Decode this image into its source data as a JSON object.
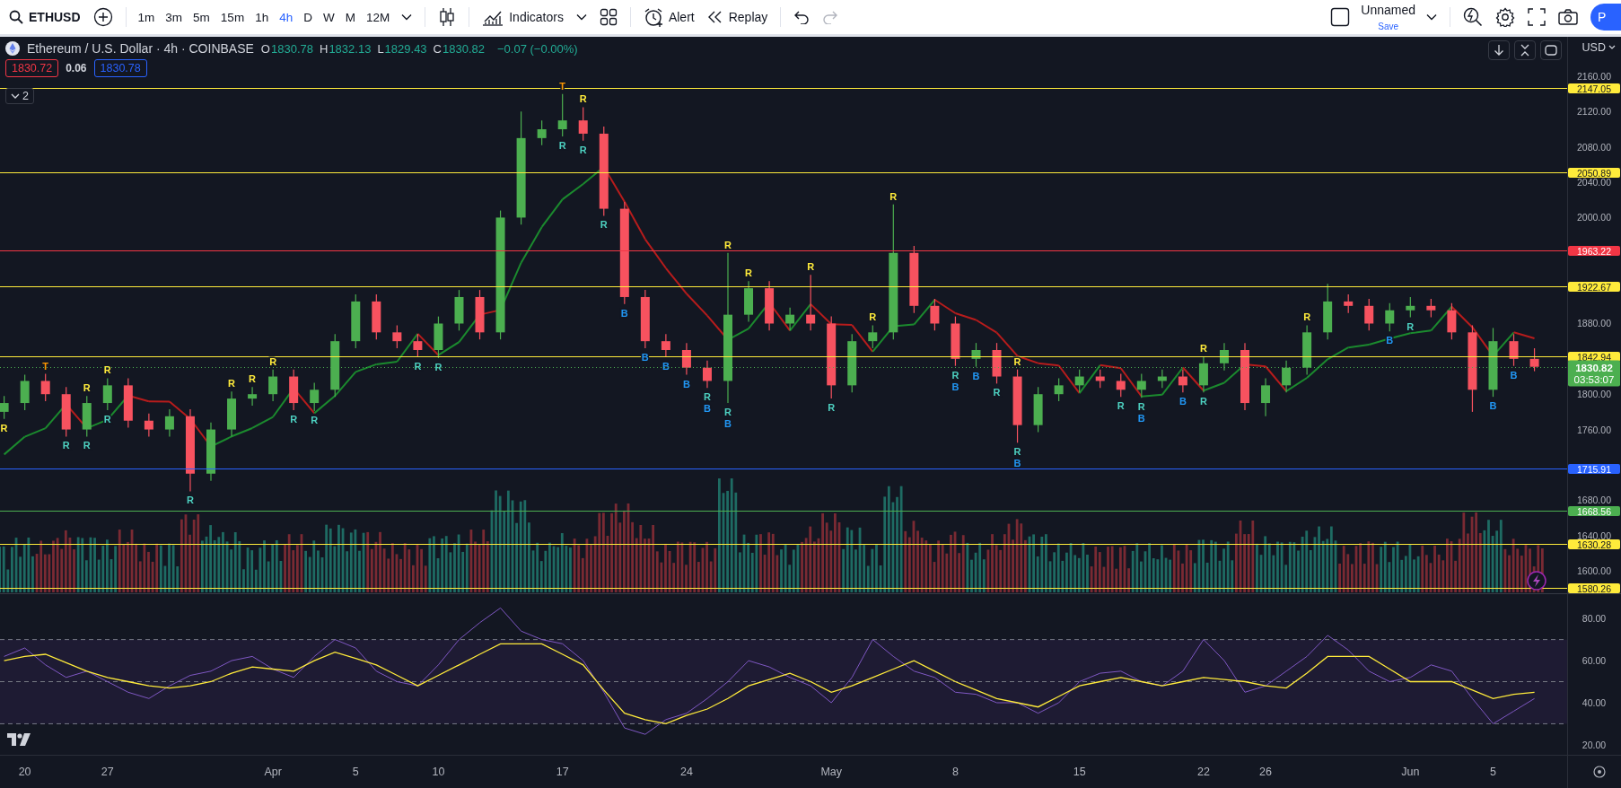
{
  "toolbar": {
    "symbol": "ETHUSD",
    "intervals": [
      {
        "label": "1m",
        "selected": false
      },
      {
        "label": "3m",
        "selected": false
      },
      {
        "label": "5m",
        "selected": false
      },
      {
        "label": "15m",
        "selected": false
      },
      {
        "label": "1h",
        "selected": false
      },
      {
        "label": "4h",
        "selected": true
      },
      {
        "label": "D",
        "selected": false
      },
      {
        "label": "W",
        "selected": false
      },
      {
        "label": "M",
        "selected": false
      },
      {
        "label": "12M",
        "selected": false
      }
    ],
    "indicators_label": "Indicators",
    "alert_label": "Alert",
    "replay_label": "Replay",
    "redo_disabled": true,
    "layout_name": "Unnamed",
    "layout_status": "Save",
    "avatar_letter": "P"
  },
  "legend": {
    "title": "Ethereum / U.S. Dollar · 4h · COINBASE",
    "ohlc": [
      {
        "key": "O",
        "value": "1830.78"
      },
      {
        "key": "H",
        "value": "1832.13"
      },
      {
        "key": "L",
        "value": "1829.43"
      },
      {
        "key": "C",
        "value": "1830.82"
      }
    ],
    "change": "−0.07 (−0.00%)",
    "bid": "1830.72",
    "spread": "0.06",
    "ask": "1830.78",
    "collapsed_count": "2"
  },
  "price_axis": {
    "currency": "USD"
  },
  "price_chart": {
    "last_price": {
      "label": "1830.82",
      "countdown": "03:53:07",
      "color": "#4caf50"
    },
    "signal_colors": [
      {
        "color": "#ffeb3b"
      },
      {
        "color": "#ff9800"
      },
      {
        "color": "#4dd0c0"
      },
      {
        "color": "#ffeb3b"
      },
      {
        "color": "#4dd0c0"
      },
      {
        "color": "#ffeb3b"
      },
      {
        "color": "#4dd0c0"
      },
      {
        "color": "#4dd0c0"
      },
      {
        "color": "#ffeb3b"
      },
      {
        "color": "#ffeb3b"
      },
      {
        "color": "#ffeb3b"
      },
      {
        "color": "#4dd0c0"
      },
      {
        "color": "#4dd0c0"
      },
      {
        "color": "#4dd0c0"
      },
      {
        "color": "#4dd0c0"
      },
      {
        "color": "#ff9800"
      },
      {
        "color": "#4dd0c0"
      },
      {
        "color": "#ffeb3b"
      },
      {
        "color": "#4dd0c0"
      },
      {
        "color": "#4dd0c0"
      },
      {
        "color": "#2196f3"
      },
      {
        "color": "#2196f3"
      },
      {
        "color": "#2196f3"
      },
      {
        "color": "#2196f3"
      },
      {
        "color": "#4dd0c0"
      },
      {
        "color": "#2196f3"
      },
      {
        "color": "#ffeb3b"
      },
      {
        "color": "#4dd0c0"
      },
      {
        "color": "#2196f3"
      },
      {
        "color": "#ffeb3b"
      },
      {
        "color": "#ffeb3b"
      },
      {
        "color": "#4dd0c0"
      },
      {
        "color": "#ffeb3b"
      },
      {
        "color": "#ffeb3b"
      },
      {
        "color": "#4dd0c0"
      },
      {
        "color": "#2196f3"
      },
      {
        "color": "#2196f3"
      },
      {
        "color": "#4dd0c0"
      },
      {
        "color": "#4dd0c0"
      },
      {
        "color": "#2196f3"
      },
      {
        "color": "#ffeb3b"
      },
      {
        "color": "#4dd0c0"
      },
      {
        "color": "#4dd0c0"
      },
      {
        "color": "#2196f3"
      },
      {
        "color": "#2196f3"
      },
      {
        "color": "#ffeb3b"
      },
      {
        "color": "#4dd0c0"
      },
      {
        "color": "#ffeb3b"
      },
      {
        "color": "#2196f3"
      },
      {
        "color": "#4dd0c0"
      },
      {
        "color": "#2196f3"
      },
      {
        "color": "#2196f3"
      }
    ],
    "chart_data": {
      "type": "candlestick",
      "ohlc": [
        [
          1780,
          1798,
          1772,
          1790
        ],
        [
          1790,
          1822,
          1782,
          1815
        ],
        [
          1815,
          1823,
          1792,
          1800
        ],
        [
          1800,
          1808,
          1752,
          1760
        ],
        [
          1760,
          1798,
          1752,
          1790
        ],
        [
          1790,
          1818,
          1782,
          1810
        ],
        [
          1810,
          1818,
          1762,
          1770
        ],
        [
          1770,
          1778,
          1752,
          1760
        ],
        [
          1760,
          1783,
          1752,
          1775
        ],
        [
          1775,
          1783,
          1690,
          1710
        ],
        [
          1710,
          1768,
          1702,
          1760
        ],
        [
          1760,
          1803,
          1752,
          1795
        ],
        [
          1795,
          1808,
          1787,
          1800
        ],
        [
          1800,
          1828,
          1792,
          1820
        ],
        [
          1820,
          1828,
          1782,
          1790
        ],
        [
          1790,
          1813,
          1781,
          1805
        ],
        [
          1805,
          1868,
          1797,
          1860
        ],
        [
          1860,
          1913,
          1852,
          1905
        ],
        [
          1905,
          1913,
          1862,
          1870
        ],
        [
          1870,
          1878,
          1852,
          1860
        ],
        [
          1860,
          1868,
          1842,
          1850
        ],
        [
          1850,
          1888,
          1841,
          1880
        ],
        [
          1880,
          1918,
          1872,
          1910
        ],
        [
          1910,
          1918,
          1862,
          1870
        ],
        [
          1870,
          2008,
          1862,
          2000
        ],
        [
          2000,
          2120,
          1992,
          2090
        ],
        [
          2090,
          2110,
          2082,
          2100
        ],
        [
          2100,
          2140,
          2092,
          2110
        ],
        [
          2110,
          2125,
          2087,
          2095
        ],
        [
          2095,
          2103,
          2002,
          2010
        ],
        [
          2010,
          2018,
          1902,
          1910
        ],
        [
          1910,
          1918,
          1852,
          1860
        ],
        [
          1860,
          1868,
          1842,
          1850
        ],
        [
          1850,
          1858,
          1822,
          1830
        ],
        [
          1830,
          1838,
          1807,
          1815
        ],
        [
          1815,
          1960,
          1790,
          1890
        ],
        [
          1890,
          1928,
          1882,
          1920
        ],
        [
          1920,
          1928,
          1872,
          1880
        ],
        [
          1880,
          1898,
          1872,
          1890
        ],
        [
          1890,
          1935,
          1872,
          1880
        ],
        [
          1880,
          1888,
          1795,
          1810
        ],
        [
          1810,
          1868,
          1802,
          1860
        ],
        [
          1860,
          1878,
          1852,
          1870
        ],
        [
          1870,
          2015,
          1862,
          1960
        ],
        [
          1960,
          1968,
          1892,
          1900
        ],
        [
          1900,
          1908,
          1872,
          1880
        ],
        [
          1880,
          1888,
          1832,
          1840
        ],
        [
          1840,
          1858,
          1831,
          1850
        ],
        [
          1850,
          1858,
          1812,
          1820
        ],
        [
          1820,
          1828,
          1745,
          1765
        ],
        [
          1765,
          1808,
          1757,
          1800
        ],
        [
          1800,
          1818,
          1792,
          1810
        ],
        [
          1810,
          1828,
          1802,
          1820
        ],
        [
          1820,
          1828,
          1807,
          1815
        ],
        [
          1815,
          1823,
          1797,
          1805
        ],
        [
          1805,
          1823,
          1796,
          1815
        ],
        [
          1815,
          1828,
          1807,
          1820
        ],
        [
          1820,
          1828,
          1802,
          1810
        ],
        [
          1810,
          1843,
          1802,
          1835
        ],
        [
          1835,
          1858,
          1827,
          1850
        ],
        [
          1850,
          1858,
          1782,
          1790
        ],
        [
          1790,
          1818,
          1775,
          1810
        ],
        [
          1810,
          1838,
          1802,
          1830
        ],
        [
          1830,
          1878,
          1822,
          1870
        ],
        [
          1870,
          1925,
          1862,
          1905
        ],
        [
          1905,
          1913,
          1892,
          1900
        ],
        [
          1900,
          1908,
          1872,
          1880
        ],
        [
          1880,
          1903,
          1871,
          1895
        ],
        [
          1895,
          1910,
          1887,
          1900
        ],
        [
          1900,
          1908,
          1887,
          1895
        ],
        [
          1895,
          1903,
          1862,
          1870
        ],
        [
          1870,
          1878,
          1780,
          1805
        ],
        [
          1805,
          1875,
          1797,
          1860
        ],
        [
          1860,
          1868,
          1832,
          1840
        ],
        [
          1840,
          1852,
          1826,
          1831
        ]
      ],
      "ylim": [
        1575.6,
        2204.7
      ],
      "yticks": [
        {
          "value": 2160,
          "label": "2160.00"
        },
        {
          "value": 2120,
          "label": "2120.00"
        },
        {
          "value": 2080,
          "label": "2080.00"
        },
        {
          "value": 2040,
          "label": "2040.00"
        },
        {
          "value": 2000,
          "label": "2000.00"
        },
        {
          "value": 1880,
          "label": "1880.00"
        },
        {
          "value": 1800,
          "label": "1800.00"
        },
        {
          "value": 1760,
          "label": "1760.00"
        },
        {
          "value": 1680,
          "label": "1680.00"
        },
        {
          "value": 1640,
          "label": "1640.00"
        },
        {
          "value": 1600,
          "label": "1600.00"
        }
      ],
      "ref_lines": [
        {
          "axis": "y",
          "value": 2147.05,
          "label": "2147.05",
          "color": "#ffeb3b"
        },
        {
          "axis": "y",
          "value": 2050.89,
          "label": "2050.89",
          "color": "#ffeb3b"
        },
        {
          "axis": "y",
          "value": 1963.22,
          "label": "1963.22",
          "color": "#f23645"
        },
        {
          "axis": "y",
          "value": 1922.67,
          "label": "1922.67",
          "color": "#ffeb3b"
        },
        {
          "axis": "y",
          "value": 1842.94,
          "label": "1842.94",
          "color": "#ffeb3b"
        },
        {
          "axis": "y",
          "value": 1715.91,
          "label": "1715.91",
          "color": "#2962ff"
        },
        {
          "axis": "y",
          "value": 1668.56,
          "label": "1668.56",
          "color": "#4caf50"
        },
        {
          "axis": "y",
          "value": 1630.28,
          "label": "1630.28",
          "color": "#ffeb3b"
        },
        {
          "axis": "y",
          "value": 1580.26,
          "label": "1580.26",
          "color": "#ffeb3b"
        }
      ],
      "annotations": [
        {
          "text": "R",
          "y": 1772
        },
        {
          "text": "T",
          "y": 1823
        },
        {
          "text": "R",
          "y": 1752
        },
        {
          "text": "R",
          "y": 1798
        },
        {
          "text": "R",
          "y": 1752
        },
        {
          "text": "R",
          "y": 1818
        },
        {
          "text": "R",
          "y": 1782
        },
        {
          "text": "R",
          "y": 1690
        },
        {
          "text": "R",
          "y": 1803
        },
        {
          "text": "R",
          "y": 1808
        },
        {
          "text": "R",
          "y": 1828
        },
        {
          "text": "R",
          "y": 1782
        },
        {
          "text": "R",
          "y": 1781
        },
        {
          "text": "R",
          "y": 1842
        },
        {
          "text": "R",
          "y": 1841
        },
        {
          "text": "T",
          "y": 2140
        },
        {
          "text": "R",
          "y": 2092
        },
        {
          "text": "R",
          "y": 2125
        },
        {
          "text": "R",
          "y": 2087
        },
        {
          "text": "R",
          "y": 2002
        },
        {
          "text": "B",
          "y": 1902
        },
        {
          "text": "B",
          "y": 1852
        },
        {
          "text": "B",
          "y": 1842
        },
        {
          "text": "B",
          "y": 1822
        },
        {
          "text": "R",
          "y": 1807
        },
        {
          "text": "B",
          "y": 1807
        },
        {
          "text": "R",
          "y": 1960
        },
        {
          "text": "R",
          "y": 1790
        },
        {
          "text": "B",
          "y": 1790
        },
        {
          "text": "R",
          "y": 1928
        },
        {
          "text": "R",
          "y": 1935
        },
        {
          "text": "R",
          "y": 1795
        },
        {
          "text": "R",
          "y": 1878
        },
        {
          "text": "R",
          "y": 2015
        },
        {
          "text": "R",
          "y": 1832
        },
        {
          "text": "B",
          "y": 1832
        },
        {
          "text": "B",
          "y": 1831
        },
        {
          "text": "R",
          "y": 1812
        },
        {
          "text": "R",
          "y": 1745
        },
        {
          "text": "B",
          "y": 1745
        },
        {
          "text": "R",
          "y": 1828
        },
        {
          "text": "R",
          "y": 1797
        },
        {
          "text": "R",
          "y": 1796
        },
        {
          "text": "B",
          "y": 1796
        },
        {
          "text": "B",
          "y": 1802
        },
        {
          "text": "R",
          "y": 1843
        },
        {
          "text": "R",
          "y": 1802
        },
        {
          "text": "R",
          "y": 1878
        },
        {
          "text": "B",
          "y": 1871
        },
        {
          "text": "R",
          "y": 1887
        },
        {
          "text": "B",
          "y": 1797
        },
        {
          "text": "B",
          "y": 1832
        }
      ]
    }
  },
  "rsi_chart": {
    "chart_data": {
      "type": "line",
      "categories": [
        null,
        "20",
        null,
        null,
        null,
        "27",
        null,
        null,
        null,
        null,
        null,
        null,
        null,
        "Apr",
        null,
        null,
        null,
        "5",
        null,
        null,
        null,
        "10",
        null,
        null,
        null,
        null,
        null,
        "17",
        null,
        null,
        null,
        null,
        null,
        "24",
        null,
        null,
        null,
        null,
        null,
        null,
        "May",
        null,
        null,
        null,
        null,
        null,
        "8",
        null,
        null,
        null,
        null,
        null,
        "15",
        null,
        null,
        null,
        null,
        null,
        "22",
        null,
        null,
        "26",
        null,
        null,
        null,
        null,
        null,
        null,
        "Jun",
        null,
        null,
        null,
        "5",
        null,
        null
      ],
      "series": [
        {
          "color": "#7e57c2",
          "values": [
            62,
            66,
            58,
            52,
            55,
            50,
            45,
            42,
            48,
            53,
            55,
            60,
            62,
            56,
            52,
            62,
            70,
            66,
            55,
            50,
            48,
            58,
            70,
            78,
            85,
            74,
            70,
            68,
            60,
            45,
            28,
            25,
            32,
            35,
            42,
            50,
            60,
            57,
            52,
            48,
            40,
            52,
            70,
            62,
            55,
            52,
            45,
            44,
            40,
            40,
            35,
            40,
            50,
            54,
            55,
            50,
            48,
            55,
            70,
            60,
            45,
            48,
            55,
            62,
            72,
            65,
            55,
            50,
            52,
            58,
            55,
            42,
            30,
            36,
            42
          ]
        },
        {
          "color": "#ffeb3b",
          "values": [
            60,
            62,
            63,
            59,
            55,
            52,
            50,
            48,
            47,
            48,
            50,
            54,
            57,
            56,
            55,
            60,
            64,
            61,
            58,
            53,
            48,
            53,
            58,
            63,
            68,
            68,
            68,
            63,
            58,
            46,
            35,
            32,
            30,
            34,
            37,
            42,
            48,
            51,
            54,
            50,
            45,
            48,
            52,
            56,
            60,
            55,
            50,
            46,
            42,
            40,
            38,
            43,
            48,
            50,
            52,
            50,
            48,
            50,
            52,
            51,
            50,
            48,
            47,
            54,
            62,
            62,
            62,
            56,
            50,
            50,
            50,
            46,
            42,
            44,
            45
          ]
        }
      ],
      "ylim": [
        -0.5,
        92
      ],
      "yticks": [
        {
          "value": 80,
          "label": "80.00"
        },
        {
          "value": 60,
          "label": "60.00"
        },
        {
          "value": 40,
          "label": "40.00"
        },
        {
          "value": 20,
          "label": "20.00"
        }
      ],
      "ref_lines": [
        {
          "axis": "y",
          "value": 70
        },
        {
          "axis": "y",
          "value": 50
        },
        {
          "axis": "y",
          "value": 30
        }
      ],
      "bands": [
        {
          "axis": "y",
          "from": 30,
          "to": 70
        }
      ]
    }
  }
}
